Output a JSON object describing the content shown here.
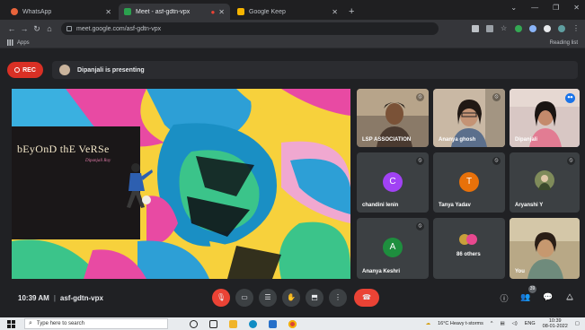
{
  "browser": {
    "tabs": [
      {
        "title": "WhatsApp",
        "favicon_color": "#e8643b",
        "active": false
      },
      {
        "title": "Meet - asf-gdtn-vpx",
        "favicon_color": "#2ba14e",
        "active": true,
        "recording": true
      },
      {
        "title": "Google Keep",
        "favicon_color": "#f6b400",
        "active": false
      }
    ],
    "url": "meet.google.com/asf-gdtn-vpx",
    "bookmarks": {
      "apps": "Apps",
      "reading_list": "Reading list"
    }
  },
  "meeting": {
    "rec_label": "REC",
    "presenting_banner": "Dipanjali is presenting",
    "time": "10:39 AM",
    "code": "asf-gdtn-vpx",
    "participant_count": "39"
  },
  "slide": {
    "title": "bEyOnD thE VeRSe",
    "author": "Dipanjali Roy"
  },
  "participants": [
    {
      "name": "LSP ASSOCIATION",
      "type": "video"
    },
    {
      "name": "Ananya ghosh",
      "type": "video"
    },
    {
      "name": "Dipanjali",
      "type": "video",
      "speaking": true
    },
    {
      "name": "chandini lenin",
      "type": "avatar",
      "initial": "C",
      "color": "#a142f4"
    },
    {
      "name": "Tanya Yadav",
      "type": "avatar",
      "initial": "T",
      "color": "#e8710a"
    },
    {
      "name": "Aryanshi Y",
      "type": "photo"
    },
    {
      "name": "Ananya Keshri",
      "type": "avatar",
      "initial": "A",
      "color": "#1e8e3e"
    },
    {
      "name": "86 others",
      "type": "others"
    },
    {
      "name": "You",
      "type": "video"
    }
  ],
  "taskbar": {
    "search_placeholder": "Type here to search",
    "weather": "16°C Heavy t-storms",
    "language": "ENG",
    "time": "10:39",
    "date": "08-01-2022"
  },
  "colors": {
    "accent": "#1a73e8",
    "danger": "#ea4335",
    "surface": "#3c4043",
    "background": "#202124"
  }
}
